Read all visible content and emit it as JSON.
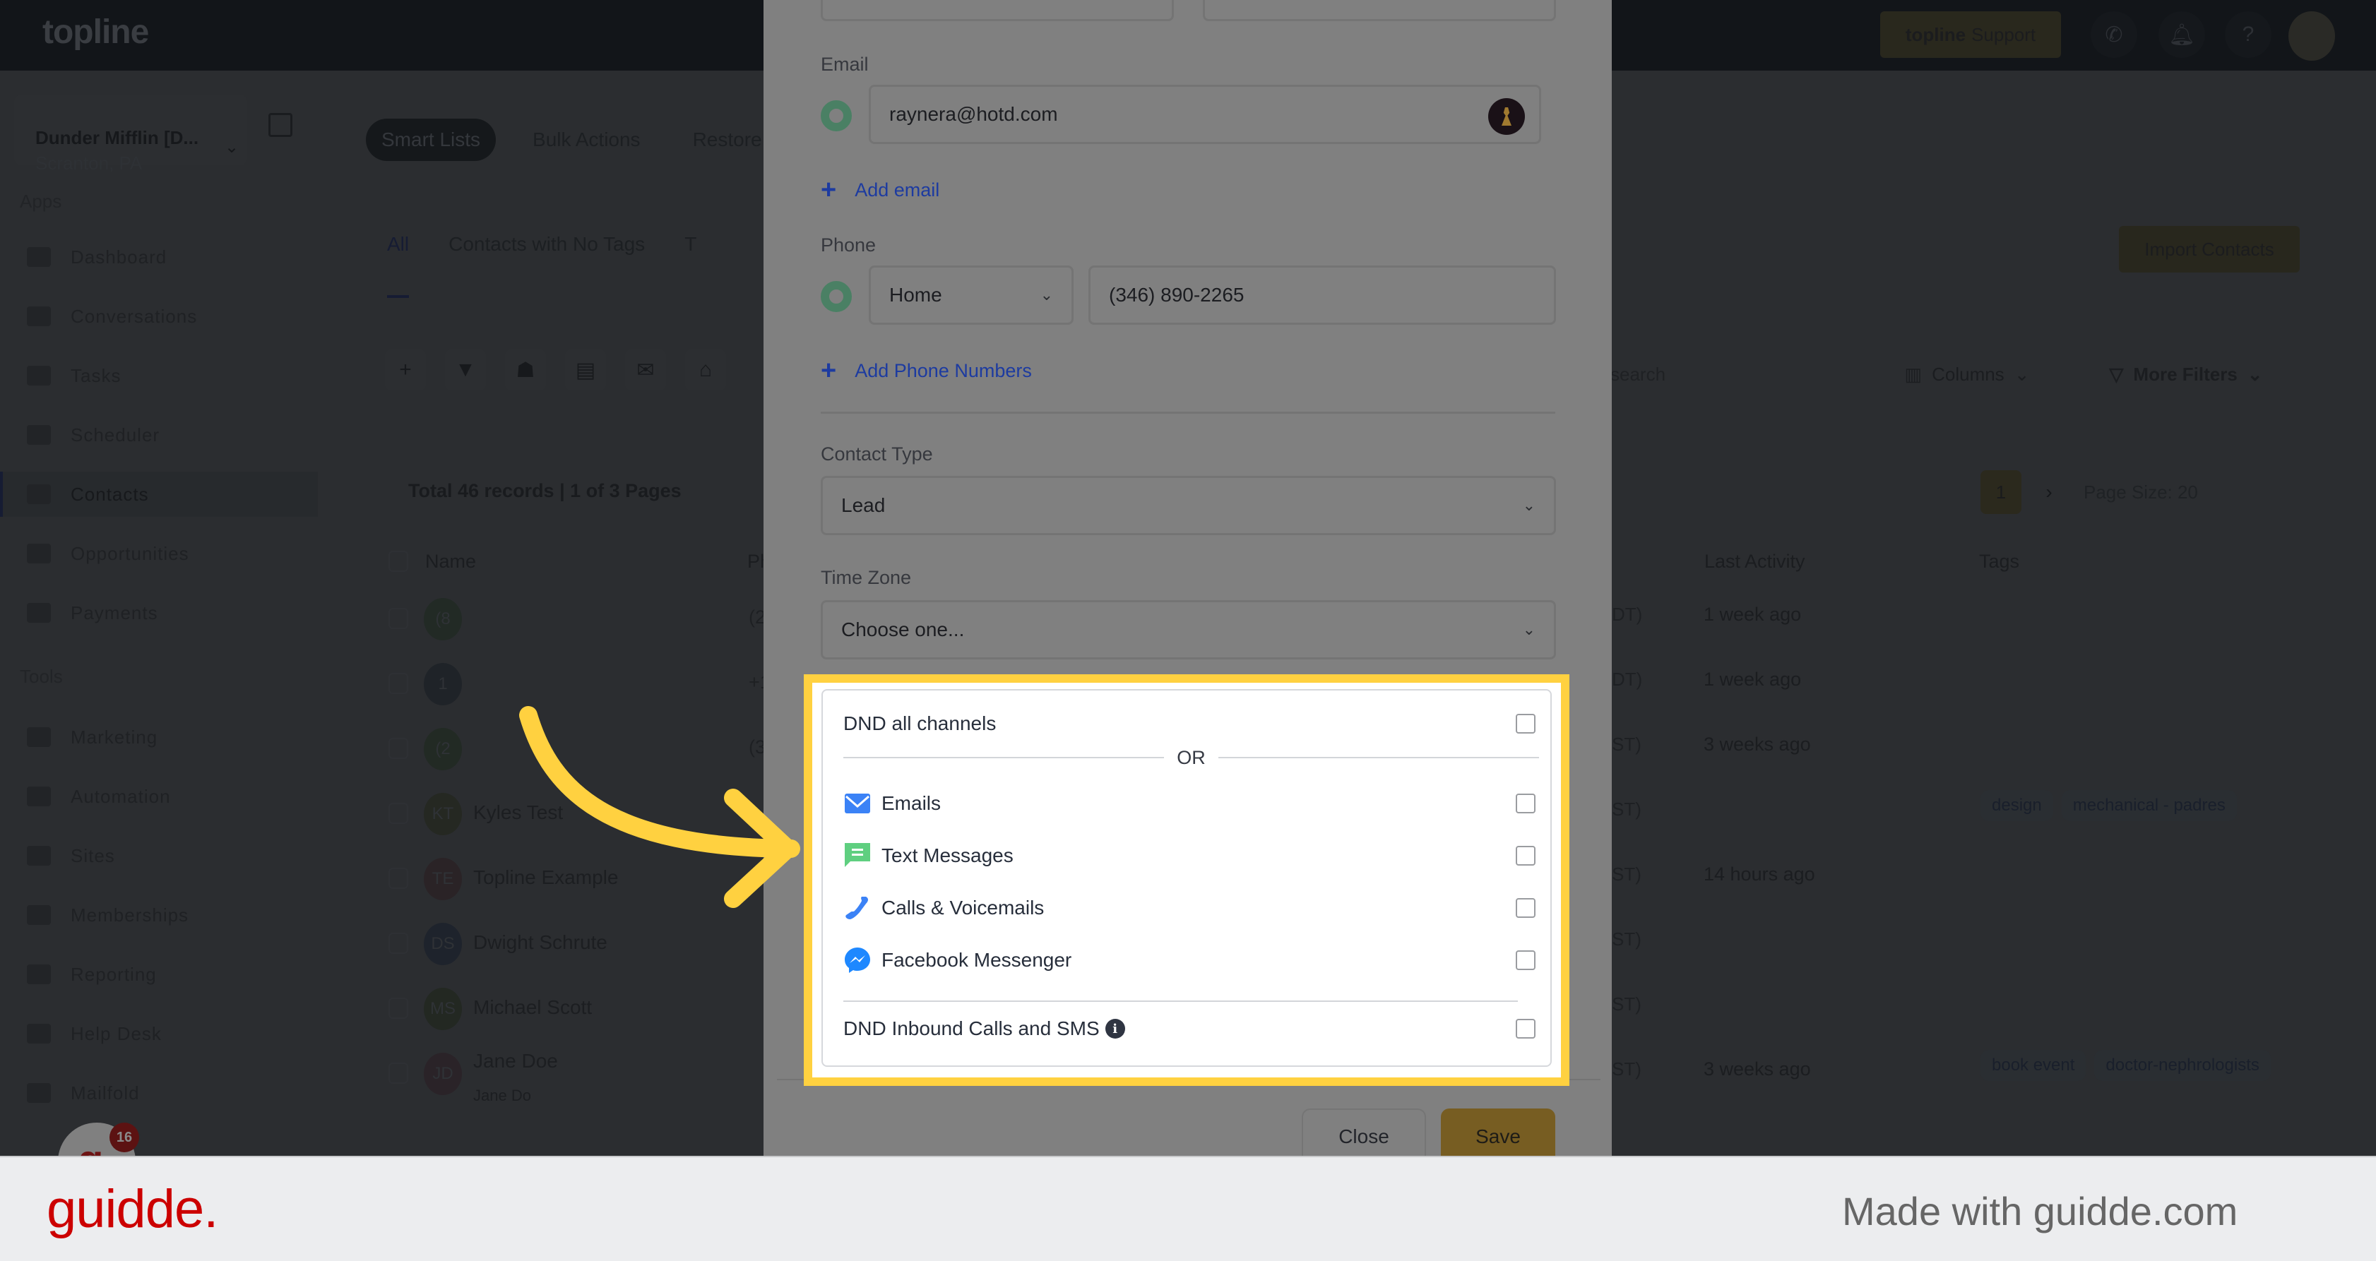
{
  "header": {
    "logo": "topline",
    "support_brand": "topline",
    "support_label": "Support",
    "icons": [
      "phone-icon",
      "bell-icon",
      "help-icon",
      "user-avatar"
    ]
  },
  "sidebar": {
    "location_name": "Dunder Mifflin [D...",
    "location_sub": "Scranton, PA",
    "apps_label": "Apps",
    "apps": [
      {
        "label": "Dashboard",
        "icon": "dashboard-icon"
      },
      {
        "label": "Conversations",
        "icon": "conversations-icon"
      },
      {
        "label": "Tasks",
        "icon": "tasks-icon"
      },
      {
        "label": "Scheduler",
        "icon": "calendar-icon"
      },
      {
        "label": "Contacts",
        "icon": "contact-icon",
        "active": true
      },
      {
        "label": "Opportunities",
        "icon": "target-icon"
      },
      {
        "label": "Payments",
        "icon": "card-icon"
      }
    ],
    "tools_label": "Tools",
    "tools": [
      {
        "label": "Marketing",
        "icon": "megaphone-icon"
      },
      {
        "label": "Automation",
        "icon": "gears-icon"
      },
      {
        "label": "Sites",
        "icon": "globe-icon"
      },
      {
        "label": "Memberships",
        "icon": "members-icon"
      },
      {
        "label": "Reporting",
        "icon": "pie-chart-icon"
      },
      {
        "label": "Help Desk",
        "icon": "help-circle-icon"
      },
      {
        "label": "Mailfold",
        "icon": "mail-stack-icon"
      }
    ],
    "chat_badge": "16"
  },
  "main": {
    "pill_tabs": [
      "Smart Lists",
      "Bulk Actions",
      "Restore"
    ],
    "list_tabs": [
      "All",
      "Contacts with No Tags",
      "T"
    ],
    "import_label": "Import Contacts",
    "search_placeholder": "search",
    "columns_label": "Columns",
    "more_filters_label": "More Filters",
    "records_text": "Total 46 records | 1 of 3 Pages",
    "current_page": "1",
    "page_size": "Page Size: 20",
    "columns": {
      "name": "Name",
      "phone": "Ph",
      "last_activity": "Last Activity",
      "tags": "Tags"
    },
    "rows": [
      {
        "initials": "(8",
        "name": "",
        "sub": "",
        "phone": "(2",
        "tz": "DT)",
        "activity": "1 week ago",
        "tags": [],
        "color": "#222a25"
      },
      {
        "initials": "1",
        "name": "",
        "sub": "",
        "phone": "+1",
        "tz": "DT)",
        "activity": "1 week ago",
        "tags": [],
        "color": "#1f2328"
      },
      {
        "initials": "(2",
        "name": "",
        "sub": "",
        "phone": "(3",
        "tz": "ST)",
        "activity": "3 weeks ago",
        "tags": [],
        "color": "#222a24"
      },
      {
        "initials": "KT",
        "name": "Kyles Test",
        "sub": "",
        "phone": "",
        "tz": "ST)",
        "activity": "",
        "tags": [
          "design",
          "mechanical - padres"
        ],
        "color": "#252822"
      },
      {
        "initials": "TE",
        "name": "Topline Example",
        "sub": "",
        "phone": "",
        "tz": "ST)",
        "activity": "14 hours ago",
        "tags": [],
        "color": "#2a2326"
      },
      {
        "initials": "DS",
        "name": "Dwight Schrute",
        "sub": "",
        "phone": "",
        "tz": "ST)",
        "activity": "",
        "tags": [],
        "color": "#1e232c"
      },
      {
        "initials": "MS",
        "name": "Michael Scott",
        "sub": "",
        "phone": "",
        "tz": "ST)",
        "activity": "",
        "tags": [],
        "color": "#232822"
      },
      {
        "initials": "JD",
        "name": "Jane Doe",
        "sub": "Jane Do",
        "phone": "",
        "tz": "ST)",
        "activity": "3 weeks ago",
        "tags": [
          "book event",
          "doctor-nephrologists"
        ],
        "color": "#2a2328"
      }
    ]
  },
  "modal": {
    "email_label": "Email",
    "email_value": "raynera@hotd.com",
    "add_email": "Add email",
    "phone_label": "Phone",
    "phone_type": "Home",
    "phone_value": "(346) 890-2265",
    "add_phone": "Add Phone Numbers",
    "contact_type_label": "Contact Type",
    "contact_type_value": "Lead",
    "timezone_label": "Time Zone",
    "timezone_value": "Choose one...",
    "dnd": {
      "all_label": "DND all channels",
      "or_label": "OR",
      "channels": [
        {
          "label": "Emails",
          "icon": "email-icon",
          "color": "#3b82f6",
          "checked": false
        },
        {
          "label": "Text Messages",
          "icon": "sms-icon",
          "color": "#5fcf80",
          "checked": false
        },
        {
          "label": "Calls & Voicemails",
          "icon": "phone-icon",
          "color": "#3b82f6",
          "checked": false
        },
        {
          "label": "Facebook Messenger",
          "icon": "messenger-icon",
          "color": "#1e88ff",
          "checked": false
        }
      ],
      "inbound_label": "DND Inbound Calls and SMS",
      "all_checked": false,
      "inbound_checked": false
    },
    "close_label": "Close",
    "save_label": "Save"
  },
  "annotation": {
    "highlight_color": "#ffd140"
  },
  "footer": {
    "brand": "guidde.",
    "made_with": "Made with guidde.com",
    "brand_color": "#cc0000"
  }
}
